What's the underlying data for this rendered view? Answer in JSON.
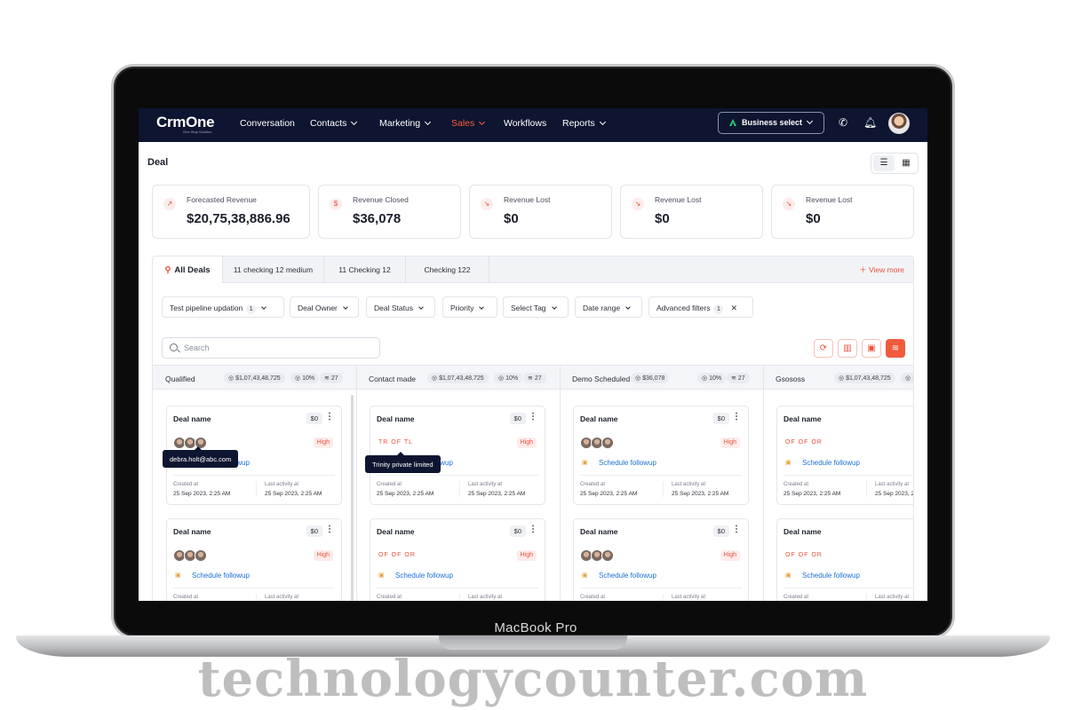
{
  "device": {
    "label": "MacBook Pro"
  },
  "watermark": "technologycounter.com",
  "colors": {
    "nav_bg": "#0d1530",
    "accent": "#e8503a",
    "link": "#1b6fd8"
  },
  "nav": {
    "logo": "CrmOne",
    "logo_sub": "One Stop Solution",
    "items": [
      {
        "label": "Conversation",
        "has_dropdown": false
      },
      {
        "label": "Contacts",
        "has_dropdown": true
      },
      {
        "label": "Marketing",
        "has_dropdown": true
      },
      {
        "label": "Sales",
        "has_dropdown": true,
        "active": true
      },
      {
        "label": "Workflows",
        "has_dropdown": false
      },
      {
        "label": "Reports",
        "has_dropdown": true
      }
    ],
    "business_select": "Business select",
    "icons": [
      "phone-icon",
      "bell-icon"
    ]
  },
  "page": {
    "title": "Deal"
  },
  "stats": [
    {
      "label": "Forecasted Revenue",
      "value": "$20,75,38,886.96",
      "icon": "chart-icon"
    },
    {
      "label": "Revenue Closed",
      "value": "$36,078",
      "icon": "money-bag-icon"
    },
    {
      "label": "Revenue Lost",
      "value": "$0",
      "icon": "trend-down-icon"
    },
    {
      "label": "Revenue Lost",
      "value": "$0",
      "icon": "trend-down-icon"
    },
    {
      "label": "Revenue Lost",
      "value": "$0",
      "icon": "trend-down-icon"
    }
  ],
  "tabs": [
    {
      "label": "All Deals",
      "active": true
    },
    {
      "label": "11 checking 12 medium"
    },
    {
      "label": "11 Checking 12"
    },
    {
      "label": "Checking 122"
    }
  ],
  "view_more": "View more",
  "filters": [
    {
      "label": "Test pipeline updation",
      "count": "1"
    },
    {
      "label": "Deal Owner"
    },
    {
      "label": "Deal Status"
    },
    {
      "label": "Priority"
    },
    {
      "label": "Select Tag"
    },
    {
      "label": "Date range"
    },
    {
      "label": "Advanced filters",
      "count": "1",
      "clearable": true
    }
  ],
  "search": {
    "placeholder": "Search"
  },
  "columns": [
    {
      "name": "Qualified",
      "amount": "$1,07,43,48,725",
      "percent": "10%",
      "count": "27"
    },
    {
      "name": "Contact made",
      "amount": "$1,07,43,48,725",
      "percent": "10%",
      "count": "27"
    },
    {
      "name": "Demo Scheduled",
      "amount": "$36,078",
      "percent": "10%",
      "count": "27"
    },
    {
      "name": "Gsososs",
      "amount": "$1,07,43,48,725",
      "percent": "10%",
      "count": "27"
    }
  ],
  "card_common": {
    "name": "Deal name",
    "amount": "$0",
    "priority": "High",
    "followup": "Schedule followup",
    "created_label": "Created at",
    "created_value": "25 Sep 2023, 2:25 AM",
    "activity_label": "Last activity at",
    "activity_value": "25 Sep 2023, 2:25 AM"
  },
  "cards": [
    {
      "col": 0,
      "row": 0,
      "people": "avatars"
    },
    {
      "col": 0,
      "row": 1,
      "people": "avatars"
    },
    {
      "col": 1,
      "row": 0,
      "people": "TR OF TL"
    },
    {
      "col": 1,
      "row": 1,
      "people": "OF OF OR"
    },
    {
      "col": 2,
      "row": 0,
      "people": "avatars"
    },
    {
      "col": 2,
      "row": 1,
      "people": "avatars"
    },
    {
      "col": 3,
      "row": 0,
      "people": "OF OF OR"
    },
    {
      "col": 3,
      "row": 1,
      "people": "OF OF OR"
    }
  ],
  "tooltips": {
    "email": "debra.holt@abc.com",
    "company": "Trinity private limited"
  }
}
